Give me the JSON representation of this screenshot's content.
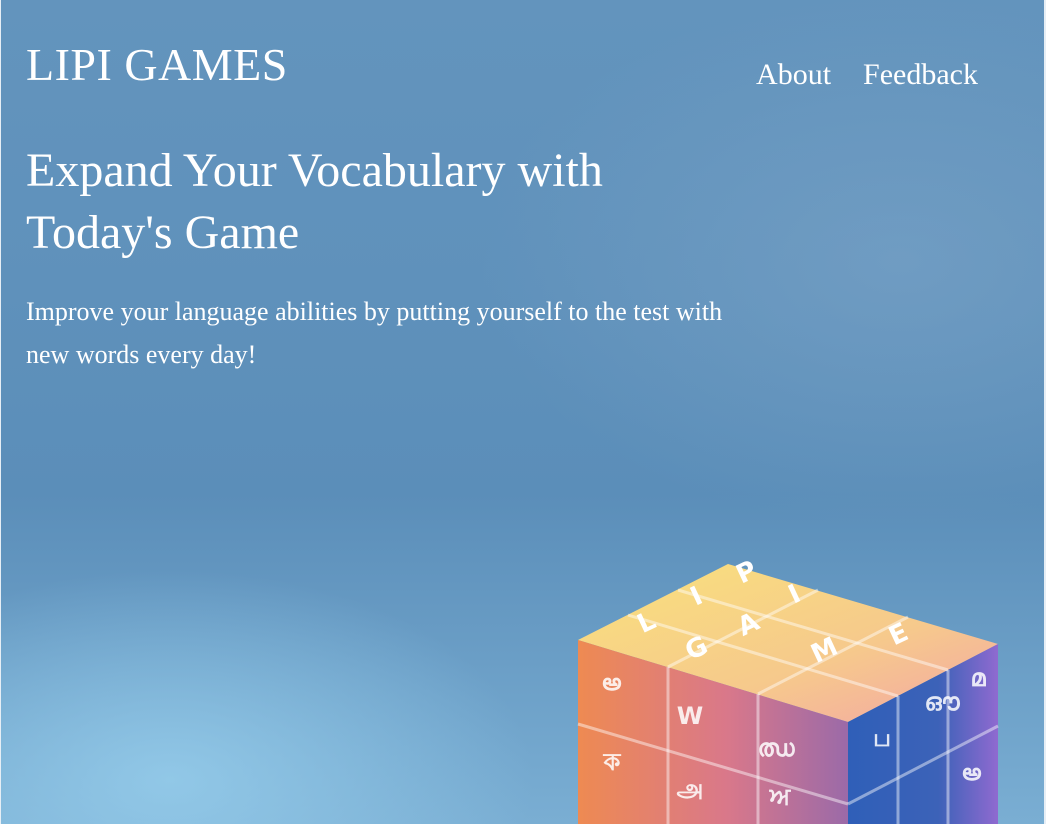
{
  "brand": {
    "logo_text": "LIPI GAMES"
  },
  "nav": {
    "items": [
      {
        "label": "About"
      },
      {
        "label": "Feedback"
      }
    ]
  },
  "hero": {
    "headline": "Expand Your Vocabulary with Today's Game",
    "subtitle": "Improve your language abilities by putting yourself to the test with new words every day!"
  },
  "cube": {
    "top_letters": [
      "L",
      "I",
      "P",
      "I",
      "G",
      "A",
      "M",
      "E"
    ],
    "side_glyphs": [
      "అ",
      "W",
      "ഝ",
      "ப",
      "ഔ",
      "മ",
      "ক",
      "அ",
      "ਅ",
      "అ"
    ]
  },
  "colors": {
    "background": "#5f91bb",
    "text": "#ffffff"
  }
}
